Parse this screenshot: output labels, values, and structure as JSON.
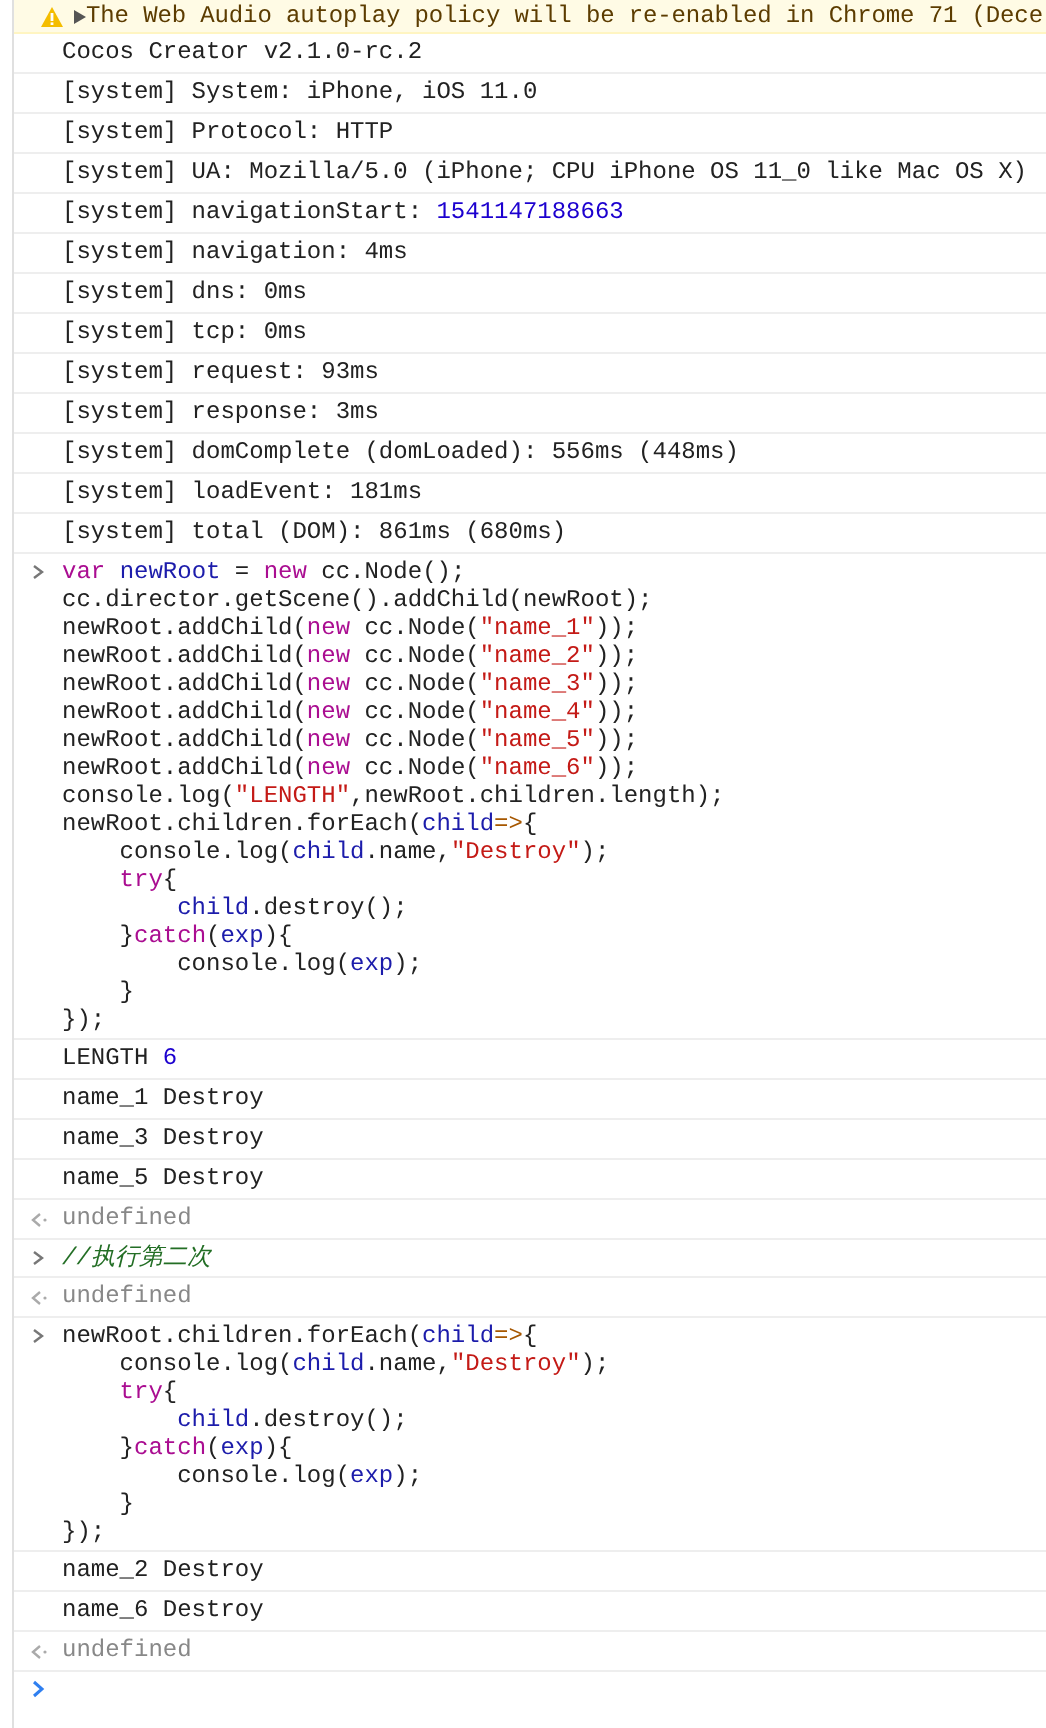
{
  "console": {
    "entries": [
      {
        "kind": "warning",
        "parts": [
          {
            "kind": "plain",
            "text": "The Web Audio autoplay policy will be re-enabled in Chrome 71 (Dece"
          }
        ]
      },
      {
        "kind": "log",
        "parts": [
          {
            "kind": "plain",
            "text": "Cocos Creator v2.1.0-rc.2"
          }
        ]
      },
      {
        "kind": "log",
        "parts": [
          {
            "kind": "plain",
            "text": "[system] System: iPhone, iOS 11.0"
          }
        ]
      },
      {
        "kind": "log",
        "parts": [
          {
            "kind": "plain",
            "text": "[system] Protocol: HTTP"
          }
        ]
      },
      {
        "kind": "log",
        "parts": [
          {
            "kind": "plain",
            "text": "[system] UA: Mozilla/5.0 (iPhone; CPU iPhone OS 11_0 like Mac OS X)"
          }
        ]
      },
      {
        "kind": "log",
        "parts": [
          {
            "kind": "plain",
            "text": "[system] navigationStart: "
          },
          {
            "kind": "number",
            "text": "1541147188663"
          }
        ]
      },
      {
        "kind": "log",
        "parts": [
          {
            "kind": "plain",
            "text": "[system] navigation: 4ms"
          }
        ]
      },
      {
        "kind": "log",
        "parts": [
          {
            "kind": "plain",
            "text": "[system] dns: 0ms"
          }
        ]
      },
      {
        "kind": "log",
        "parts": [
          {
            "kind": "plain",
            "text": "[system] tcp: 0ms"
          }
        ]
      },
      {
        "kind": "log",
        "parts": [
          {
            "kind": "plain",
            "text": "[system] request: 93ms"
          }
        ]
      },
      {
        "kind": "log",
        "parts": [
          {
            "kind": "plain",
            "text": "[system] response: 3ms"
          }
        ]
      },
      {
        "kind": "log",
        "parts": [
          {
            "kind": "plain",
            "text": "[system] domComplete (domLoaded): 556ms (448ms)"
          }
        ]
      },
      {
        "kind": "log",
        "parts": [
          {
            "kind": "plain",
            "text": "[system] loadEvent: 181ms"
          }
        ]
      },
      {
        "kind": "log",
        "parts": [
          {
            "kind": "plain",
            "text": "[system] total (DOM): 861ms (680ms)"
          }
        ]
      },
      {
        "kind": "input",
        "lines": [
          [
            {
              "kind": "keyword",
              "text": "var "
            },
            {
              "kind": "variable",
              "text": "newRoot"
            },
            {
              "kind": "plain",
              "text": " = "
            },
            {
              "kind": "keyword",
              "text": "new"
            },
            {
              "kind": "plain",
              "text": " cc.Node();"
            }
          ],
          [
            {
              "kind": "plain",
              "text": "cc.director.getScene().addChild(newRoot);"
            }
          ],
          [
            {
              "kind": "plain",
              "text": "newRoot.addChild("
            },
            {
              "kind": "keyword",
              "text": "new"
            },
            {
              "kind": "plain",
              "text": " cc.Node("
            },
            {
              "kind": "string",
              "text": "\"name_1\""
            },
            {
              "kind": "plain",
              "text": "));"
            }
          ],
          [
            {
              "kind": "plain",
              "text": "newRoot.addChild("
            },
            {
              "kind": "keyword",
              "text": "new"
            },
            {
              "kind": "plain",
              "text": " cc.Node("
            },
            {
              "kind": "string",
              "text": "\"name_2\""
            },
            {
              "kind": "plain",
              "text": "));"
            }
          ],
          [
            {
              "kind": "plain",
              "text": "newRoot.addChild("
            },
            {
              "kind": "keyword",
              "text": "new"
            },
            {
              "kind": "plain",
              "text": " cc.Node("
            },
            {
              "kind": "string",
              "text": "\"name_3\""
            },
            {
              "kind": "plain",
              "text": "));"
            }
          ],
          [
            {
              "kind": "plain",
              "text": "newRoot.addChild("
            },
            {
              "kind": "keyword",
              "text": "new"
            },
            {
              "kind": "plain",
              "text": " cc.Node("
            },
            {
              "kind": "string",
              "text": "\"name_4\""
            },
            {
              "kind": "plain",
              "text": "));"
            }
          ],
          [
            {
              "kind": "plain",
              "text": "newRoot.addChild("
            },
            {
              "kind": "keyword",
              "text": "new"
            },
            {
              "kind": "plain",
              "text": " cc.Node("
            },
            {
              "kind": "string",
              "text": "\"name_5\""
            },
            {
              "kind": "plain",
              "text": "));"
            }
          ],
          [
            {
              "kind": "plain",
              "text": "newRoot.addChild("
            },
            {
              "kind": "keyword",
              "text": "new"
            },
            {
              "kind": "plain",
              "text": " cc.Node("
            },
            {
              "kind": "string",
              "text": "\"name_6\""
            },
            {
              "kind": "plain",
              "text": "));"
            }
          ],
          [
            {
              "kind": "plain",
              "text": "console.log("
            },
            {
              "kind": "string",
              "text": "\"LENGTH\""
            },
            {
              "kind": "plain",
              "text": ",newRoot.children.length);"
            }
          ],
          [
            {
              "kind": "plain",
              "text": "newRoot.children.forEach("
            },
            {
              "kind": "variable",
              "text": "child"
            },
            {
              "kind": "operator",
              "text": "=>"
            },
            {
              "kind": "plain",
              "text": "{"
            }
          ],
          [
            {
              "kind": "plain",
              "text": "    console.log("
            },
            {
              "kind": "variable",
              "text": "child"
            },
            {
              "kind": "plain",
              "text": ".name,"
            },
            {
              "kind": "string",
              "text": "\"Destroy\""
            },
            {
              "kind": "plain",
              "text": ");"
            }
          ],
          [
            {
              "kind": "keyword",
              "text": "    try"
            },
            {
              "kind": "plain",
              "text": "{"
            }
          ],
          [
            {
              "kind": "variable",
              "text": "        child"
            },
            {
              "kind": "plain",
              "text": ".destroy();"
            }
          ],
          [
            {
              "kind": "plain",
              "text": "    }"
            },
            {
              "kind": "keyword",
              "text": "catch"
            },
            {
              "kind": "plain",
              "text": "("
            },
            {
              "kind": "variable",
              "text": "exp"
            },
            {
              "kind": "plain",
              "text": "){"
            }
          ],
          [
            {
              "kind": "plain",
              "text": "        console.log("
            },
            {
              "kind": "variable",
              "text": "exp"
            },
            {
              "kind": "plain",
              "text": ");"
            }
          ],
          [
            {
              "kind": "plain",
              "text": "    }"
            }
          ],
          [
            {
              "kind": "plain",
              "text": "});"
            }
          ]
        ]
      },
      {
        "kind": "log",
        "parts": [
          {
            "kind": "plain",
            "text": "LENGTH "
          },
          {
            "kind": "number",
            "text": "6"
          }
        ]
      },
      {
        "kind": "log",
        "parts": [
          {
            "kind": "plain",
            "text": "name_1 Destroy"
          }
        ]
      },
      {
        "kind": "log",
        "parts": [
          {
            "kind": "plain",
            "text": "name_3 Destroy"
          }
        ]
      },
      {
        "kind": "log",
        "parts": [
          {
            "kind": "plain",
            "text": "name_5 Destroy"
          }
        ]
      },
      {
        "kind": "result",
        "parts": [
          {
            "kind": "plain",
            "text": "undefined"
          }
        ]
      },
      {
        "kind": "input",
        "lines": [
          [
            {
              "kind": "comment",
              "text": "//执行第二次"
            }
          ]
        ]
      },
      {
        "kind": "result",
        "parts": [
          {
            "kind": "plain",
            "text": "undefined"
          }
        ]
      },
      {
        "kind": "input",
        "lines": [
          [
            {
              "kind": "plain",
              "text": "newRoot.children.forEach("
            },
            {
              "kind": "variable",
              "text": "child"
            },
            {
              "kind": "operator",
              "text": "=>"
            },
            {
              "kind": "plain",
              "text": "{"
            }
          ],
          [
            {
              "kind": "plain",
              "text": "    console.log("
            },
            {
              "kind": "variable",
              "text": "child"
            },
            {
              "kind": "plain",
              "text": ".name,"
            },
            {
              "kind": "string",
              "text": "\"Destroy\""
            },
            {
              "kind": "plain",
              "text": ");"
            }
          ],
          [
            {
              "kind": "keyword",
              "text": "    try"
            },
            {
              "kind": "plain",
              "text": "{"
            }
          ],
          [
            {
              "kind": "variable",
              "text": "        child"
            },
            {
              "kind": "plain",
              "text": ".destroy();"
            }
          ],
          [
            {
              "kind": "plain",
              "text": "    }"
            },
            {
              "kind": "keyword",
              "text": "catch"
            },
            {
              "kind": "plain",
              "text": "("
            },
            {
              "kind": "variable",
              "text": "exp"
            },
            {
              "kind": "plain",
              "text": "){"
            }
          ],
          [
            {
              "kind": "plain",
              "text": "        console.log("
            },
            {
              "kind": "variable",
              "text": "exp"
            },
            {
              "kind": "plain",
              "text": ");"
            }
          ],
          [
            {
              "kind": "plain",
              "text": "    }"
            }
          ],
          [
            {
              "kind": "plain",
              "text": "});"
            }
          ]
        ]
      },
      {
        "kind": "log",
        "parts": [
          {
            "kind": "plain",
            "text": "name_2 Destroy"
          }
        ]
      },
      {
        "kind": "log",
        "parts": [
          {
            "kind": "plain",
            "text": "name_6 Destroy"
          }
        ]
      },
      {
        "kind": "result",
        "parts": [
          {
            "kind": "plain",
            "text": "undefined"
          }
        ]
      },
      {
        "kind": "prompt"
      }
    ]
  }
}
